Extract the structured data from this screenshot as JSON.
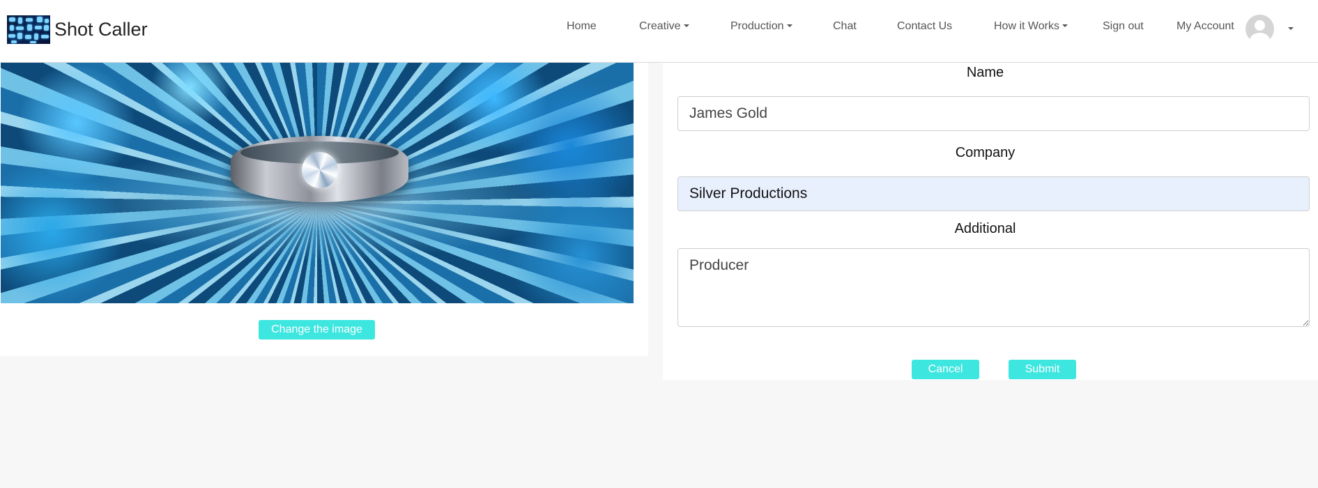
{
  "brand": {
    "name": "Shot Caller",
    "logo_icon": "mosaic-logo-icon"
  },
  "nav": {
    "home": "Home",
    "creative": "Creative",
    "production": "Production",
    "chat": "Chat",
    "contact": "Contact Us",
    "how_it_works": "How it Works",
    "sign_out": "Sign out",
    "my_account": "My Account"
  },
  "image_panel": {
    "change_button": "Change the image"
  },
  "form": {
    "name_label": "Name",
    "name_value": "James Gold",
    "company_label": "Company",
    "company_value": "Silver Productions",
    "additional_label": "Additional",
    "additional_value": "Producer",
    "cancel_label": "Cancel",
    "submit_label": "Submit"
  },
  "colors": {
    "accent": "#3ee6e0",
    "autofill_bg": "#e8f0fe",
    "page_bg": "#f7f7f7"
  }
}
